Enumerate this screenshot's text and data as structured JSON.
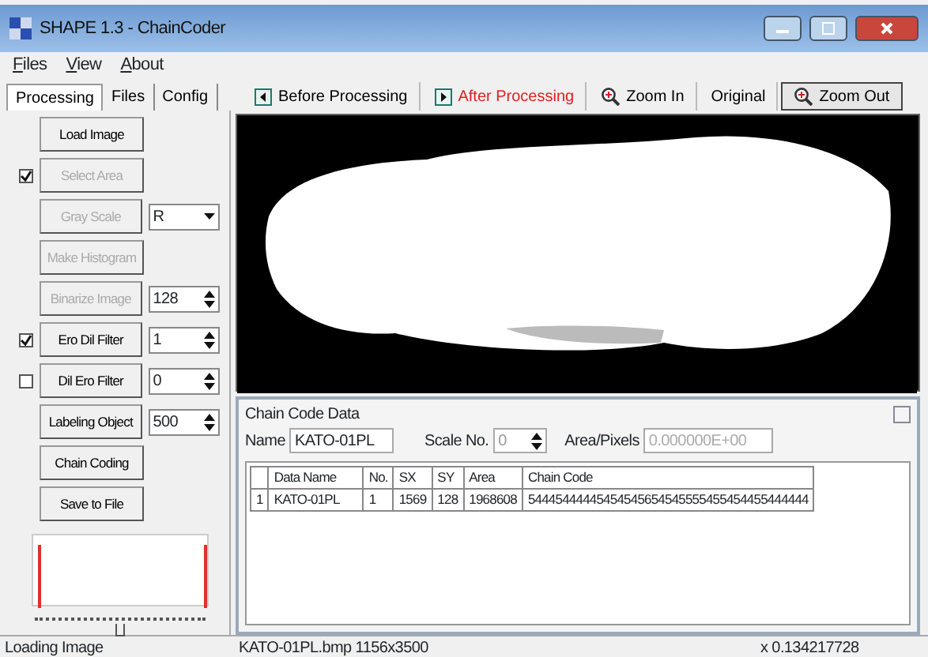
{
  "window": {
    "title": "SHAPE 1.3 - ChainCoder"
  },
  "menu": [
    {
      "label": "Files"
    },
    {
      "label": "View"
    },
    {
      "label": "About"
    }
  ],
  "tabs": [
    {
      "label": "Processing",
      "selected": true
    },
    {
      "label": "Files",
      "selected": false
    },
    {
      "label": "Config",
      "selected": false
    }
  ],
  "toolbar": [
    {
      "label": "Before Processing",
      "kind": "prev",
      "selected": false,
      "pressed": false
    },
    {
      "label": "After Processing",
      "kind": "next",
      "selected": true,
      "pressed": false
    },
    {
      "label": "Zoom In",
      "kind": "zoom",
      "selected": false,
      "pressed": false
    },
    {
      "label": "Original",
      "kind": "plain",
      "selected": false,
      "pressed": false
    },
    {
      "label": "Zoom Out",
      "kind": "zoom",
      "selected": false,
      "pressed": true
    }
  ],
  "controls": [
    {
      "label": "Load Image",
      "disabled": false
    },
    {
      "label": "Select Area",
      "disabled": true,
      "checked": true
    },
    {
      "label": "Gray Scale",
      "disabled": true,
      "field": {
        "kind": "select",
        "value": "R"
      }
    },
    {
      "label": "Make Histogram",
      "disabled": true
    },
    {
      "label": "Binarize Image",
      "disabled": true,
      "field": {
        "kind": "spin",
        "value": "128"
      }
    },
    {
      "label": "Ero Dil Filter",
      "disabled": false,
      "checked": true,
      "field": {
        "kind": "spin",
        "value": "1"
      }
    },
    {
      "label": "Dil Ero Filter",
      "disabled": false,
      "checked": false,
      "field": {
        "kind": "spin",
        "value": "0"
      }
    },
    {
      "label": "Labeling Object",
      "disabled": false,
      "field": {
        "kind": "spin",
        "value": "500"
      }
    },
    {
      "label": "Chain Coding",
      "disabled": false
    },
    {
      "label": "Save to File",
      "disabled": false
    }
  ],
  "histogram": {
    "slider": {
      "level": 0.5
    }
  },
  "chain_panel": {
    "title": "Chain Code Data",
    "name_label": "Name",
    "name_value": "KATO-01PL",
    "scale_label": "Scale No.",
    "scale_value": "0",
    "area_label": "Area/Pixels",
    "area_value": "0.000000E+00",
    "table": {
      "columns": [
        "Data Name",
        "No.",
        "SX",
        "SY",
        "Area",
        "Chain Code"
      ],
      "rows": [
        {
          "index": "1",
          "cells": [
            "KATO-01PL",
            "1",
            "1569",
            "128",
            "1968608",
            "54445444445454545654545555455454455444444"
          ]
        }
      ]
    }
  },
  "status_bar": [
    "Loading Image",
    "KATO-01PL.bmp 1156x3500",
    "x 0.134217728"
  ]
}
